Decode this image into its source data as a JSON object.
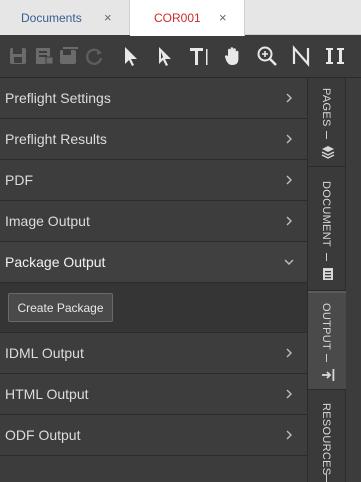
{
  "tabs": [
    {
      "label": "Documents",
      "close": "×"
    },
    {
      "label": "COR001",
      "close": "×"
    }
  ],
  "toolbar": {
    "tools": [
      "save-icon",
      "save-as-icon",
      "save-all-icon",
      "refresh-icon",
      "select-icon",
      "direct-select-icon",
      "text-tool-icon",
      "hand-icon",
      "zoom-icon",
      "path-icon",
      "column-icon"
    ]
  },
  "panel": {
    "items": [
      {
        "label": "Preflight Settings"
      },
      {
        "label": "Preflight Results"
      },
      {
        "label": "PDF"
      },
      {
        "label": "Image Output"
      },
      {
        "label": "Package Output"
      },
      {
        "label": "IDML Output"
      },
      {
        "label": "HTML Output"
      },
      {
        "label": "ODF Output"
      }
    ],
    "create_package_label": "Create Package"
  },
  "side_tabs": [
    {
      "label": "PAGES",
      "icon": "layers-icon"
    },
    {
      "label": "DOCUMENT",
      "icon": "document-icon"
    },
    {
      "label": "OUTPUT",
      "icon": "export-icon"
    },
    {
      "label": "RESOURCES",
      "icon": ""
    }
  ]
}
